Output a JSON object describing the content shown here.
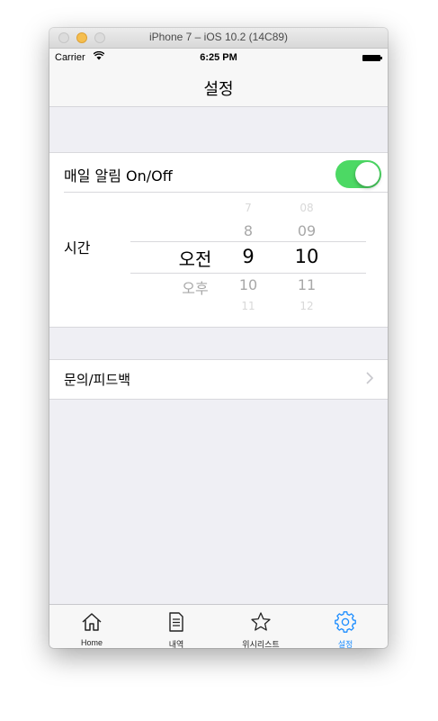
{
  "window": {
    "title": "iPhone 7 – iOS 10.2 (14C89)"
  },
  "status_bar": {
    "carrier": "Carrier",
    "time": "6:25 PM"
  },
  "nav": {
    "title": "설정"
  },
  "notification": {
    "label": "매일 알림 On/Off",
    "enabled": true
  },
  "time_setting": {
    "label": "시간",
    "ampm": {
      "selected": "오전",
      "items": [
        "오전",
        "오후"
      ]
    },
    "hours": {
      "selected": "9",
      "items": [
        "7",
        "8",
        "9",
        "10",
        "11"
      ]
    },
    "minutes": {
      "selected": "10",
      "items": [
        "08",
        "09",
        "10",
        "11",
        "12"
      ]
    }
  },
  "feedback": {
    "label": "문의/피드백"
  },
  "tabs": [
    {
      "label": "Home",
      "icon": "home-icon",
      "active": false
    },
    {
      "label": "내역",
      "icon": "document-icon",
      "active": false
    },
    {
      "label": "위시리스트",
      "icon": "star-icon",
      "active": false
    },
    {
      "label": "설정",
      "icon": "gear-icon",
      "active": true
    }
  ],
  "colors": {
    "toggle_on": "#4cd964",
    "active_tab": "#1a8cff",
    "background": "#efeff4"
  }
}
